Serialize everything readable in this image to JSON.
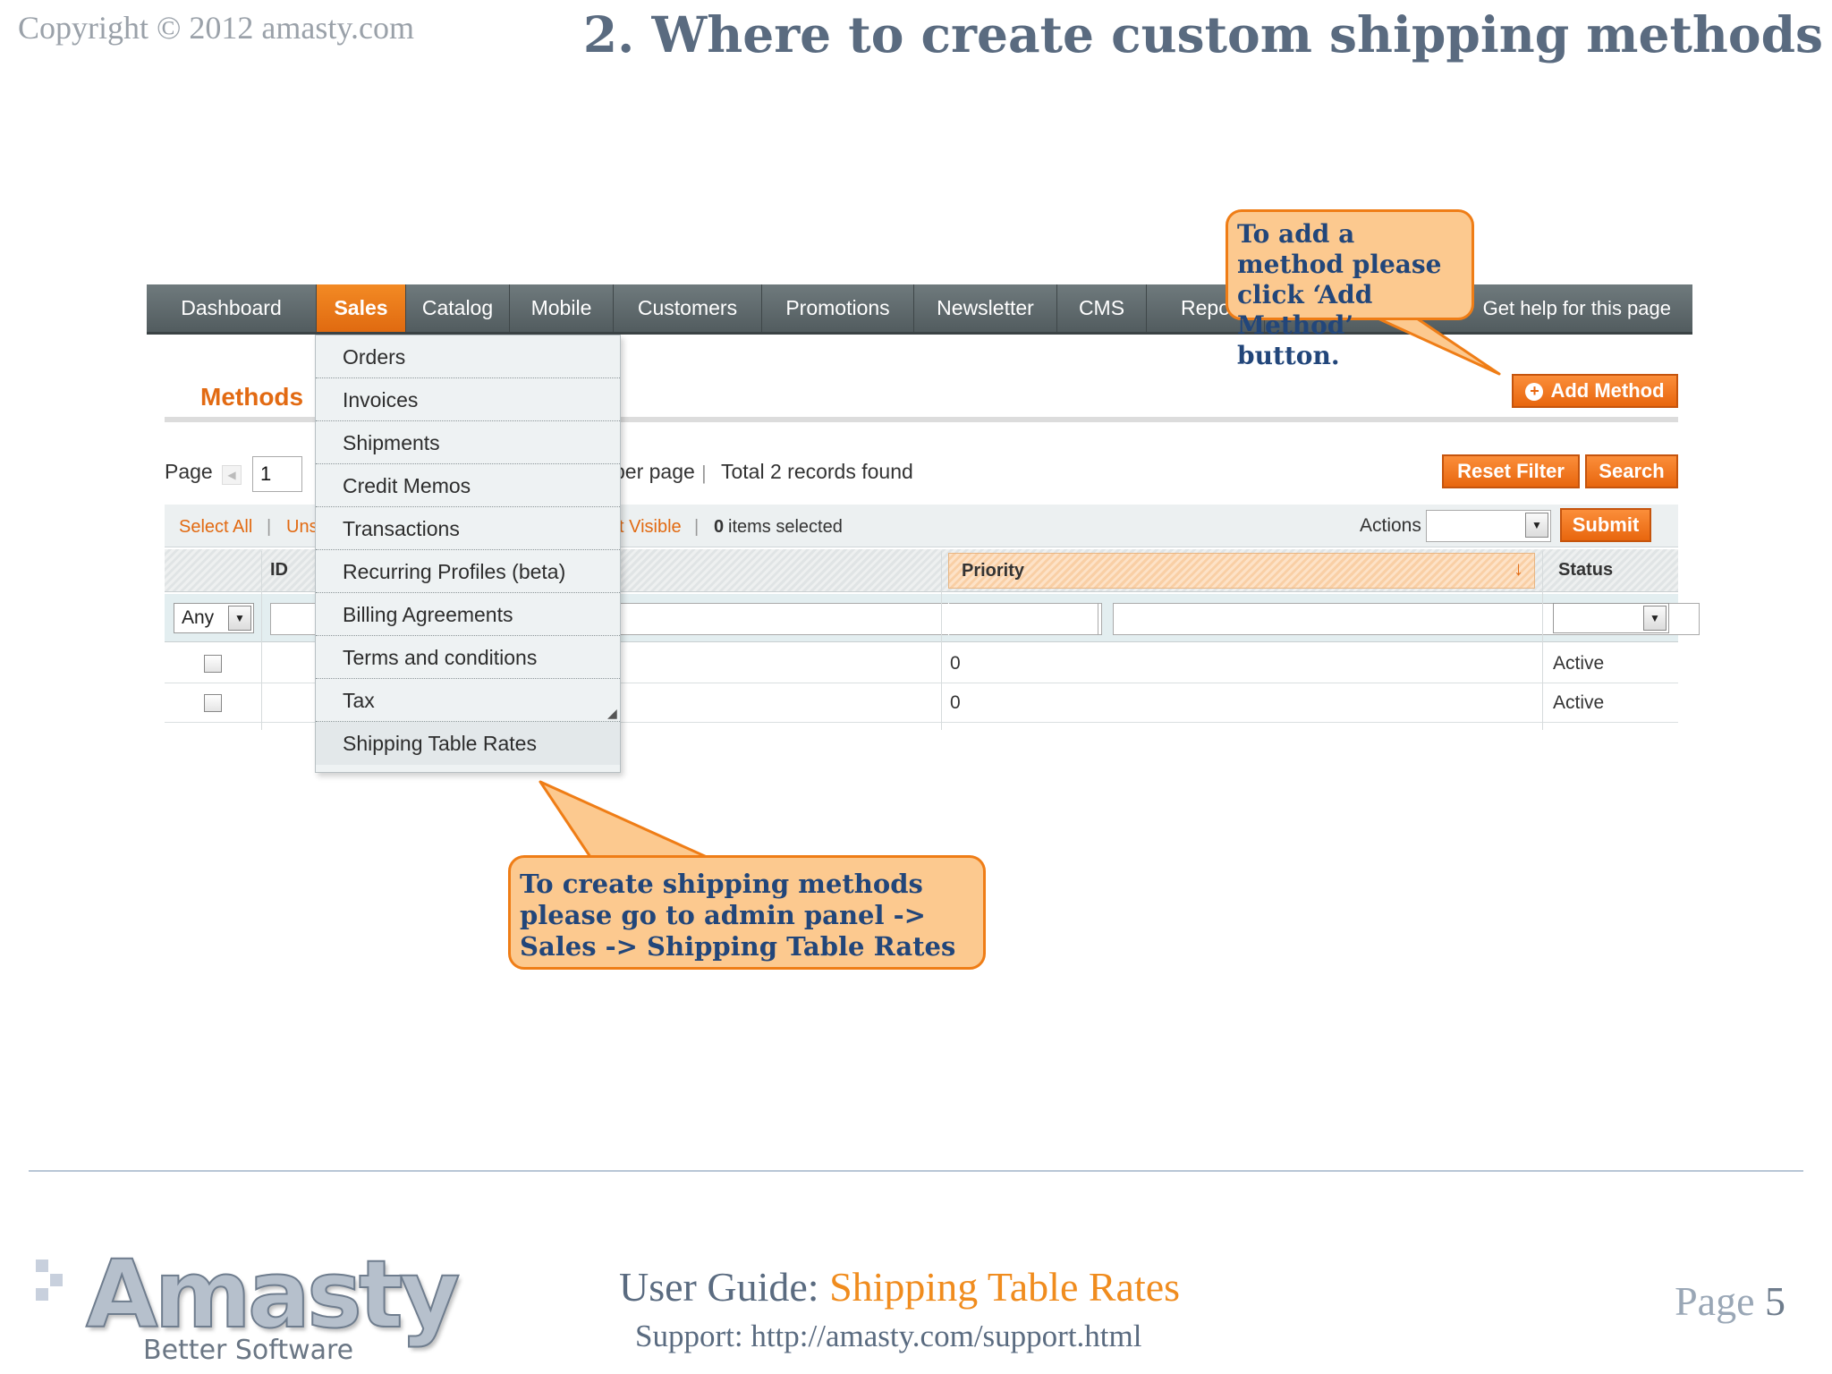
{
  "header": {
    "copyright": "Copyright © 2012 amasty.com",
    "title": "2. Where to create custom shipping methods"
  },
  "nav": {
    "items": [
      "Dashboard",
      "Sales",
      "Catalog",
      "Mobile",
      "Customers",
      "Promotions",
      "Newsletter",
      "CMS",
      "Repo"
    ],
    "active": "Sales",
    "help": "Get help for this page"
  },
  "sales_menu": {
    "items": [
      "Orders",
      "Invoices",
      "Shipments",
      "Credit Memos",
      "Transactions",
      "Recurring Profiles (beta)",
      "Billing Agreements",
      "Terms and conditions",
      "Tax",
      "Shipping Table Rates"
    ]
  },
  "page": {
    "title": "Methods",
    "add_button": "Add Method"
  },
  "pager": {
    "label": "Page",
    "current_page": "1",
    "per_page_fragment": "per page",
    "separator": "|",
    "records": "Total 2 records found",
    "reset_filter": "Reset Filter",
    "search": "Search"
  },
  "massaction": {
    "select_all": "Select All",
    "separator": "|",
    "unselect_fragment": "Uns",
    "visible_fragment": "t Visible",
    "selected_count": "0",
    "selected_text": "items selected",
    "actions_label": "Actions",
    "submit": "Submit"
  },
  "grid": {
    "columns": {
      "id": "ID",
      "priority": "Priority",
      "status": "Status"
    },
    "sort_arrow": "↓",
    "filter_any": "Any",
    "rows": [
      {
        "priority": "0",
        "status": "Active"
      },
      {
        "priority": "0",
        "status": "Active"
      }
    ]
  },
  "callouts": {
    "add_method": "To add a method please click ‘Add Method’ button.",
    "create_methods": "To create shipping methods please go to admin panel -> Sales -> Shipping Table Rates"
  },
  "footer": {
    "logo_word": "Amasty",
    "logo_tagline": "Better Software",
    "guide_prefix": "User Guide: ",
    "guide_product": "Shipping Table Rates",
    "support": "Support: http://amasty.com/support.html",
    "page_label": "Page ",
    "page_number": "5"
  },
  "colors": {
    "accent_orange": "#ef7d16",
    "nav_dark": "#5e686b",
    "heading_slate": "#5a6b80",
    "callout_fill": "#fcc98f",
    "callout_text": "#22467a"
  },
  "icons": {
    "add": "plus-circle-icon",
    "dropdown": "chevron-down-icon",
    "prev_page": "arrow-left-icon"
  }
}
